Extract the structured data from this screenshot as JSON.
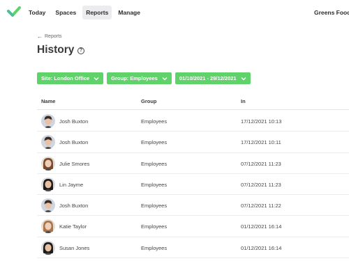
{
  "nav": {
    "items": [
      {
        "label": "Today",
        "active": false
      },
      {
        "label": "Spaces",
        "active": false
      },
      {
        "label": "Reports",
        "active": true
      },
      {
        "label": "Manage",
        "active": false
      }
    ],
    "org_name": "Greens Food S",
    "brand_color": "#5fd36a"
  },
  "page": {
    "back_label": "Reports",
    "title": "History",
    "help_icon": "?"
  },
  "filters": {
    "site": "Site: London Office",
    "group": "Group: Employees",
    "date_range": "01/10/2021 - 29/12/2021"
  },
  "table": {
    "headers": {
      "name": "Name",
      "group": "Group",
      "in": "In"
    },
    "rows": [
      {
        "name": "Josh Buxton",
        "group": "Employees",
        "in": "17/12/2021 10:13",
        "avatar": "male-short-hair"
      },
      {
        "name": "Josh Buxton",
        "group": "Employees",
        "in": "17/12/2021 10:11",
        "avatar": "male-short-hair"
      },
      {
        "name": "Julie Smores",
        "group": "Employees",
        "in": "07/12/2021 11:23",
        "avatar": "female-long-brown-hair"
      },
      {
        "name": "Lin Jayme",
        "group": "Employees",
        "in": "07/12/2021 11:23",
        "avatar": "female-dark-hair"
      },
      {
        "name": "Josh Buxton",
        "group": "Employees",
        "in": "07/12/2021 11:22",
        "avatar": "male-short-hair"
      },
      {
        "name": "Katie Taylor",
        "group": "Employees",
        "in": "01/12/2021 16:14",
        "avatar": "female-light-brown-hair"
      },
      {
        "name": "Susan Jones",
        "group": "Employees",
        "in": "01/12/2021 16:14",
        "avatar": "female-dark-hair"
      }
    ]
  }
}
